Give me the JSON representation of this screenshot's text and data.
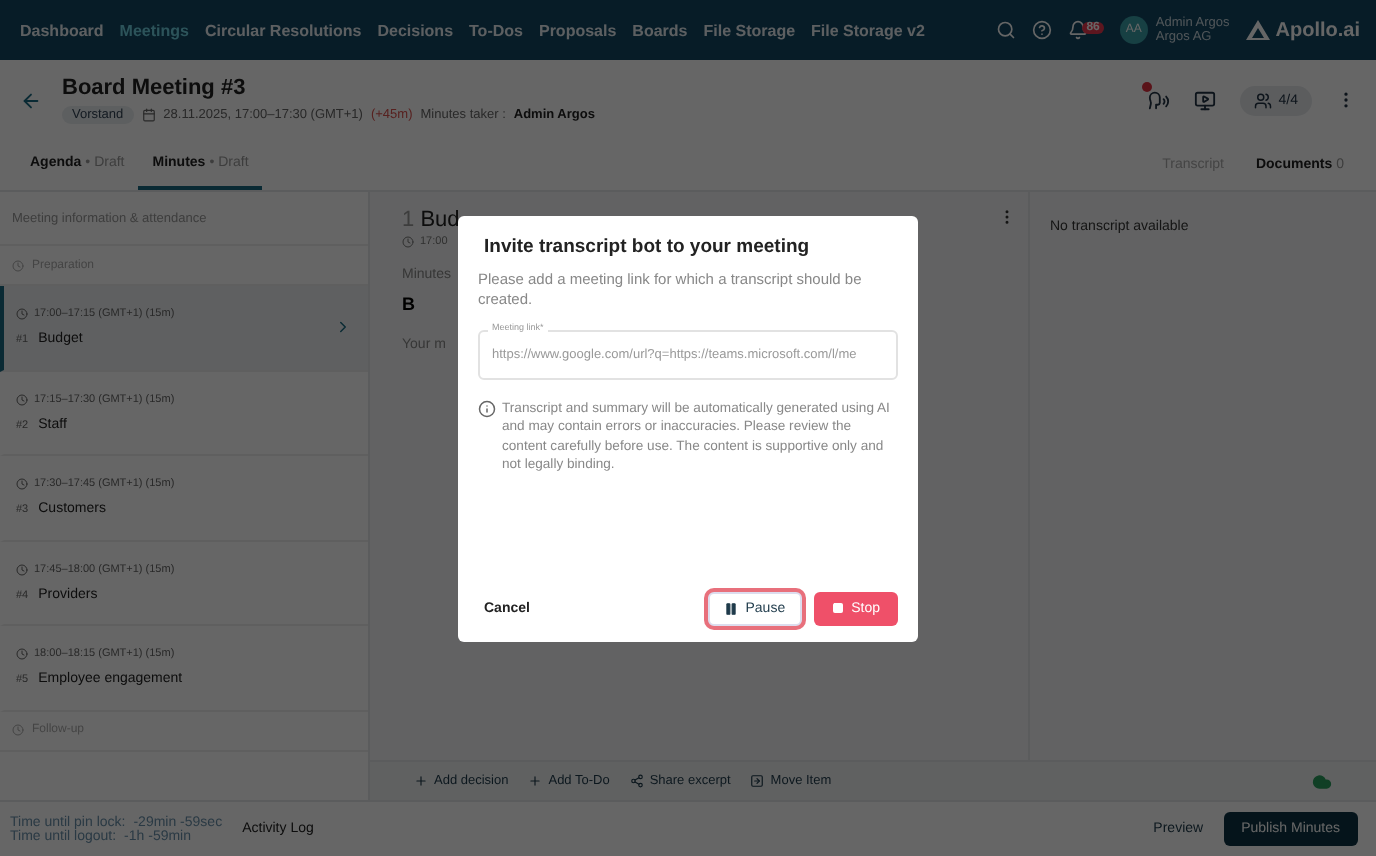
{
  "nav": {
    "items": [
      {
        "label": "Dashboard",
        "selected": false
      },
      {
        "label": "Meetings",
        "selected": true
      },
      {
        "label": "Circular Resolutions",
        "selected": false
      },
      {
        "label": "Decisions",
        "selected": false
      },
      {
        "label": "To-Dos",
        "selected": false
      },
      {
        "label": "Proposals",
        "selected": false
      },
      {
        "label": "Boards",
        "selected": false
      },
      {
        "label": "File Storage",
        "selected": false
      },
      {
        "label": "File Storage v2",
        "selected": false
      }
    ],
    "notifications": "86",
    "initials": "AA",
    "user_name": "Admin Argos",
    "org": "Argos AG",
    "logo": "Apollo.ai"
  },
  "header": {
    "title": "Board Meeting #3",
    "tag": "Vorstand",
    "datetime": "28.11.2025, 17:00–17:30 (GMT+1)",
    "overrun": "(+45m)",
    "minutes_taker_label": "Minutes taker :",
    "minutes_taker": "Admin Argos",
    "recording": true,
    "participants": "4/4"
  },
  "tabs": [
    {
      "label": "Agenda",
      "separator": "•",
      "status": "Draft",
      "selected": false
    },
    {
      "label": "Minutes",
      "separator": "•",
      "status": "Draft",
      "selected": true
    }
  ],
  "side_tabs": [
    {
      "label": "Transcript",
      "selected": false
    },
    {
      "label": "Documents",
      "count": "0",
      "selected": true
    }
  ],
  "sidebar": {
    "header": "Meeting information & attendance",
    "items": [
      {
        "kind": "section",
        "label": "Preparation"
      },
      {
        "kind": "item",
        "time": "17:00–17:15 (GMT+1) (15m)",
        "number": "#1",
        "title": "Budget",
        "selected": true
      },
      {
        "kind": "item",
        "time": "17:15–17:30 (GMT+1) (15m)",
        "number": "#2",
        "title": "Staff",
        "selected": false
      },
      {
        "kind": "item",
        "time": "17:30–17:45 (GMT+1) (15m)",
        "number": "#3",
        "title": "Customers",
        "selected": false
      },
      {
        "kind": "item",
        "time": "17:45–18:00 (GMT+1) (15m)",
        "number": "#4",
        "title": "Providers",
        "selected": false
      },
      {
        "kind": "item",
        "time": "18:00–18:15 (GMT+1) (15m)",
        "number": "#5",
        "title": "Employee engagement",
        "selected": false
      },
      {
        "kind": "section",
        "label": "Follow-up"
      }
    ]
  },
  "editor": {
    "number": "1",
    "title": "Bud",
    "time": "17:00",
    "minutes_label": "Minutes",
    "bold_button": "B",
    "placeholder": "Your m"
  },
  "transcript": {
    "empty": "No transcript available"
  },
  "actions": [
    {
      "kind": "add",
      "label": "Add decision"
    },
    {
      "kind": "add",
      "label": "Add To-Do"
    },
    {
      "kind": "share",
      "label": "Share excerpt"
    },
    {
      "kind": "move",
      "label": "Move Item"
    }
  ],
  "footer": {
    "activity_log": "Activity Log",
    "preview": "Preview",
    "publish": "Publish Minutes"
  },
  "timers": [
    {
      "label": "Time until pin lock:",
      "value": "-29min -59sec"
    },
    {
      "label": "Time until logout:",
      "value": "-1h -59min"
    }
  ],
  "modal": {
    "title": "Invite transcript bot to your meeting",
    "description": "Please add a meeting link for which a transcript should be created.",
    "field": {
      "label": "Meeting link*",
      "placeholder": "https://www.google.com/url?q=https://teams.microsoft.com/l/me"
    },
    "info": "Transcript and summary will be automatically generated using AI and may contain errors or inaccuracies. Please review the content carefully before use. The content is supportive only and not legally binding.",
    "cancel": "Cancel",
    "pause": {
      "label": "Pause",
      "focused": true
    },
    "stop": "Stop"
  }
}
